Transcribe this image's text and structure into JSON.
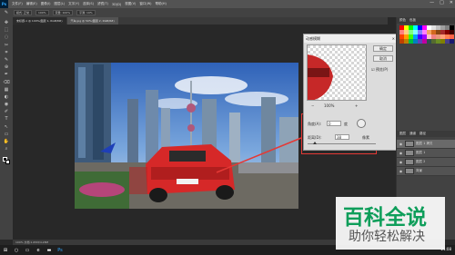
{
  "app": {
    "logo": "Ps",
    "menu": [
      "文件(F)",
      "编辑(E)",
      "图像(I)",
      "图层(L)",
      "文字(Y)",
      "选择(S)",
      "滤镜(T)",
      "3D(D)",
      "视图(V)",
      "窗口(W)",
      "帮助(H)"
    ],
    "window_controls": [
      "—",
      "□",
      "✕"
    ]
  },
  "options_bar": {
    "items": [
      "模式: 正常",
      "100%",
      "流量: 100%",
      "平滑: 10%"
    ]
  },
  "tabs": [
    {
      "label": "未标题-1 @ 100%(图层 1, RGB/8#)",
      "active": true
    },
    {
      "label": "汽车.jpg @ 50%(图层 2, RGB/8#)",
      "active": false
    }
  ],
  "tools": [
    "✥",
    "⬚",
    "◌",
    "✂",
    "⌗",
    "✎",
    "⊕",
    "✒",
    "⌫",
    "▦",
    "◐",
    "◉",
    "✐",
    "T",
    "↖",
    "▭",
    "✋",
    "⌕"
  ],
  "dialog": {
    "title": "动感模糊",
    "close": "✕",
    "ok": "确定",
    "cancel": "取消",
    "preview_label": "预览(P)",
    "zoom": "100%",
    "angle_label": "角度(A):",
    "angle_value": "0",
    "angle_unit": "度",
    "distance_label": "距离(D):",
    "distance_value": "38",
    "distance_unit": "像素",
    "zoom_out": "−",
    "zoom_in": "+"
  },
  "panel": {
    "head_tabs": [
      "颜色",
      "色板"
    ],
    "layers_head": [
      "图层",
      "通道",
      "路径"
    ],
    "layers": [
      {
        "name": "图层 1 拷贝",
        "selected": true
      },
      {
        "name": "图层 1",
        "selected": false
      },
      {
        "name": "图层 2",
        "selected": false
      },
      {
        "name": "背景",
        "selected": false
      }
    ],
    "swatch_colors": [
      "#ff0000",
      "#ffff00",
      "#00ff00",
      "#00ffff",
      "#0000ff",
      "#ff00ff",
      "#ffffff",
      "#e0e0e0",
      "#c0c0c0",
      "#a0a0a0",
      "#808080",
      "#000000",
      "#ff8080",
      "#ffd080",
      "#80ff80",
      "#80ffff",
      "#8080ff",
      "#ff80ff",
      "#f4a460",
      "#d2691e",
      "#8b4513",
      "#a52a2a",
      "#800000",
      "#400000",
      "#ff4000",
      "#ffa000",
      "#40ff00",
      "#00a0ff",
      "#4000ff",
      "#a000ff",
      "#ffc0cb",
      "#f08080",
      "#e9967a",
      "#ffa07a",
      "#ff7f50",
      "#ff6347",
      "#c04000",
      "#c08000",
      "#00c040",
      "#0080c0",
      "#6040c0",
      "#c000a0",
      "#2f4f4f",
      "#556b2f",
      "#6b8e23",
      "#808000",
      "#483d8b",
      "#191970"
    ]
  },
  "status": {
    "text": "100%   文档:1.65M/4.28M"
  },
  "taskbar": {
    "clock": "21:08"
  },
  "watermark": {
    "line1": "百科全说",
    "line2": "助你轻松解决"
  },
  "colors": {
    "accent_red": "#e53935",
    "ps_blue": "#31a8ff",
    "wm_green": "#0e9e5a"
  }
}
